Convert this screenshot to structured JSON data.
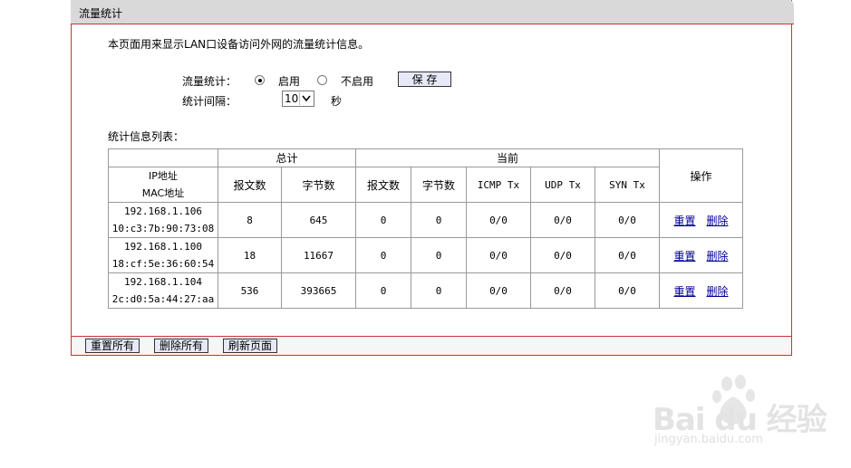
{
  "panel": {
    "title": "流量统计"
  },
  "description": "本页面用来显示LAN口设备访问外网的流量统计信息。",
  "settings": {
    "stat_label": "流量统计：",
    "enable_label": "启用",
    "disable_label": "不启用",
    "enabled": true,
    "save_label": "保 存",
    "interval_label": "统计间隔：",
    "interval_value": "10",
    "interval_unit": "秒"
  },
  "table": {
    "caption": "统计信息列表：",
    "group_total": "总计",
    "group_current": "当前",
    "col_ip": "IP地址",
    "col_mac": "MAC地址",
    "col_packets": "报文数",
    "col_bytes": "字节数",
    "col_icmp": "ICMP Tx",
    "col_udp": "UDP Tx",
    "col_syn": "SYN Tx",
    "col_ops": "操作",
    "reset_label": "重置",
    "delete_label": "删除",
    "rows": [
      {
        "ip": "192.168.1.106",
        "mac": "10:c3:7b:90:73:08",
        "total_packets": "8",
        "total_bytes": "645",
        "cur_packets": "0",
        "cur_bytes": "0",
        "icmp": "0/0",
        "udp": "0/0",
        "syn": "0/0"
      },
      {
        "ip": "192.168.1.100",
        "mac": "18:cf:5e:36:60:54",
        "total_packets": "18",
        "total_bytes": "11667",
        "cur_packets": "0",
        "cur_bytes": "0",
        "icmp": "0/0",
        "udp": "0/0",
        "syn": "0/0"
      },
      {
        "ip": "192.168.1.104",
        "mac": "2c:d0:5a:44:27:aa",
        "total_packets": "536",
        "total_bytes": "393665",
        "cur_packets": "0",
        "cur_bytes": "0",
        "icmp": "0/0",
        "udp": "0/0",
        "syn": "0/0"
      }
    ]
  },
  "footer": {
    "reset_all": "重置所有",
    "delete_all": "删除所有",
    "refresh": "刷新页面"
  },
  "watermark": {
    "brand": "Bai du 经验",
    "url": "jingyan.baidu.com"
  }
}
